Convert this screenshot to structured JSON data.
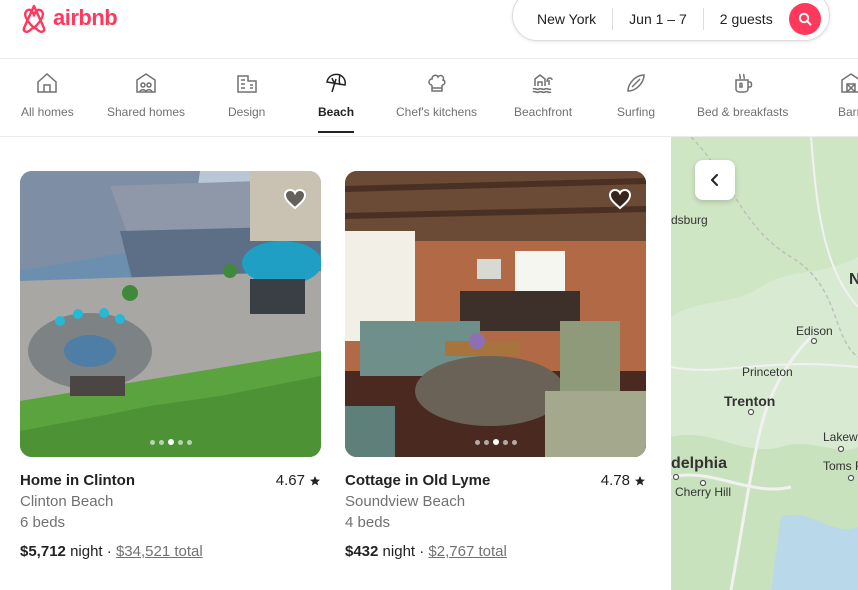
{
  "brand": {
    "name": "airbnb",
    "color": "#ff385c"
  },
  "search": {
    "location": "New York",
    "dates": "Jun 1 – 7",
    "guests": "2 guests",
    "icon": "search-icon"
  },
  "categories": [
    {
      "label": "All homes",
      "icon": "house-icon",
      "active": false
    },
    {
      "label": "Shared homes",
      "icon": "shared-homes-icon",
      "active": false
    },
    {
      "label": "Design",
      "icon": "design-icon",
      "active": false
    },
    {
      "label": "Beach",
      "icon": "umbrella-icon",
      "active": true
    },
    {
      "label": "Chef's kitchens",
      "icon": "chef-hat-icon",
      "active": false
    },
    {
      "label": "Beachfront",
      "icon": "beachfront-icon",
      "active": false
    },
    {
      "label": "Surfing",
      "icon": "surfboard-icon",
      "active": false
    },
    {
      "label": "Bed & breakfasts",
      "icon": "breakfast-icon",
      "active": false
    },
    {
      "label": "Barn",
      "icon": "barn-icon",
      "active": false
    }
  ],
  "listings": [
    {
      "title": "Home in Clinton",
      "rating": "4.67",
      "location": "Clinton Beach",
      "beds": "6 beds",
      "price": "$5,712",
      "price_unit": "night",
      "separator": "·",
      "total": "$34,521 total",
      "image": "patio-photo",
      "photo_index": 3,
      "photo_count": 5
    },
    {
      "title": "Cottage in Old Lyme",
      "rating": "4.78",
      "location": "Soundview Beach",
      "beds": "4 beds",
      "price": "$432",
      "price_unit": "night",
      "separator": "·",
      "total": "$2,767 total",
      "image": "living-room-photo",
      "photo_index": 3,
      "photo_count": 5
    }
  ],
  "map": {
    "labels": [
      "dsburg",
      "N",
      "Edison",
      "Princeton",
      "Trenton",
      "Lakew",
      "delphia",
      "Toms R",
      "Cherry Hill"
    ]
  }
}
